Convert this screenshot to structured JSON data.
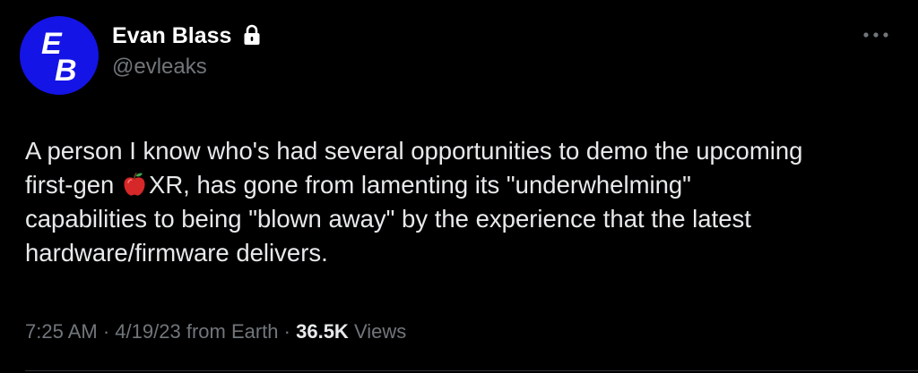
{
  "author": {
    "display_name": "Evan Blass",
    "handle": "@evleaks",
    "avatar_letter_1": "E",
    "avatar_letter_2": "B",
    "avatar_color": "#1414e6",
    "protected": true
  },
  "tweet": {
    "lines": [
      {
        "before": "A person I know who's had several opportunities to demo the upcoming",
        "emoji": null,
        "after": ""
      },
      {
        "before": "first-gen ",
        "emoji": "apple-emoji",
        "after": "XR, has gone from lamenting its \"underwhelming\""
      },
      {
        "before": "capabilities to being \"blown away\" by the experience that the latest",
        "emoji": null,
        "after": ""
      },
      {
        "before": "hardware/firmware delivers.",
        "emoji": null,
        "after": ""
      }
    ]
  },
  "meta": {
    "time": "7:25 AM",
    "separator": "·",
    "date": "4/19/23",
    "source": "from Earth",
    "views_count": "36.5K",
    "views_label": "Views"
  },
  "icons": {
    "lock": "lock-icon",
    "more": "more-options-icon"
  },
  "colors": {
    "background": "#000000",
    "primary_text": "#e7e9ea",
    "secondary_text": "#71767b"
  }
}
